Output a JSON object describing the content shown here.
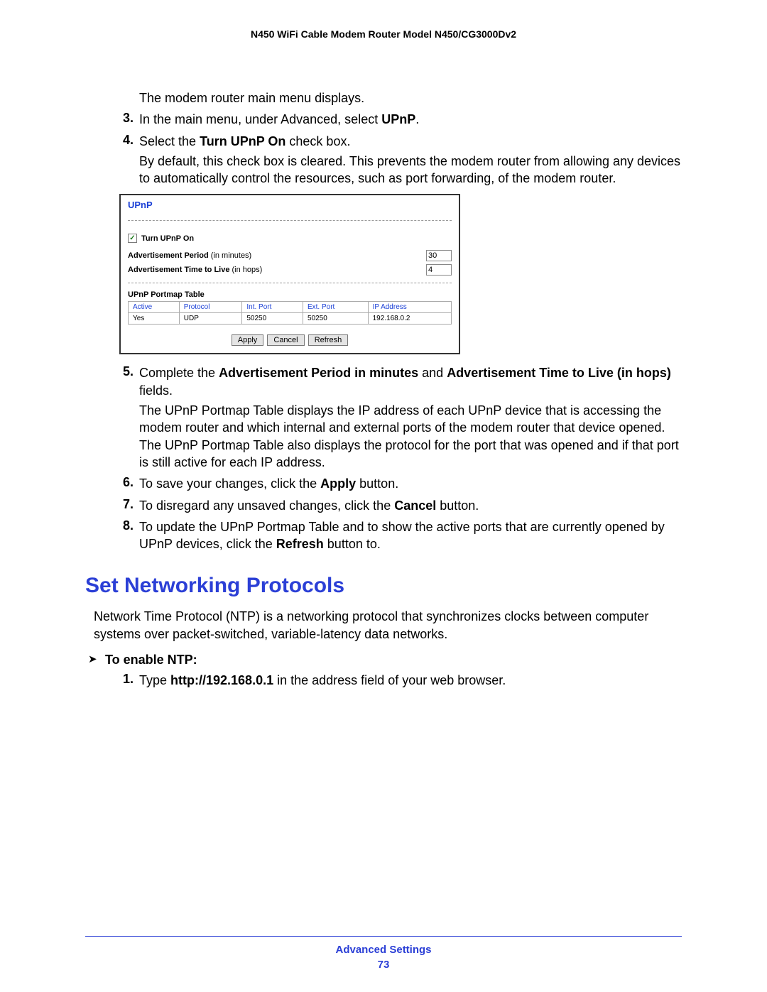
{
  "header": {
    "title": "N450 WiFi Cable Modem Router Model N450/CG3000Dv2"
  },
  "intro_continuation": "The modem router main menu displays.",
  "steps": [
    {
      "num": "3.",
      "parts": [
        "In the main menu, under Advanced, select ",
        "UPnP",
        "."
      ]
    },
    {
      "num": "4.",
      "parts": [
        "Select the ",
        "Turn UPnP On",
        " check box."
      ],
      "continuation": "By default, this check box is cleared. This prevents the modem router from allowing any devices to automatically control the resources, such as port forwarding, of the modem router."
    },
    {
      "num": "5.",
      "parts": [
        "Complete the ",
        "Advertisement Period in minutes",
        " and ",
        "Advertisement Time to Live (in hops)",
        " fields."
      ],
      "continuation": "The UPnP Portmap Table displays the IP address of each UPnP device that is accessing the modem router and which internal and external ports of the modem router that device opened. The UPnP Portmap Table also displays the protocol for the port that was opened and if that port is still active for each IP address."
    },
    {
      "num": "6.",
      "parts": [
        "To save your changes, click the ",
        "Apply",
        " button."
      ]
    },
    {
      "num": "7.",
      "parts": [
        "To disregard any unsaved changes, click the ",
        "Cancel",
        " button."
      ]
    },
    {
      "num": "8.",
      "parts": [
        "To update the UPnP Portmap Table and to show the active ports that are currently opened by UPnP devices, click the ",
        "Refresh",
        " button to."
      ]
    }
  ],
  "upnp_panel": {
    "title": "UPnP",
    "checkbox_label": "Turn UPnP On",
    "checkbox_checked": "✓",
    "field1_bold": "Advertisement Period",
    "field1_rest": " (in minutes)",
    "field1_value": "30",
    "field2_bold": "Advertisement Time to Live",
    "field2_rest": " (in hops)",
    "field2_value": "4",
    "table_title": "UPnP Portmap Table",
    "headers": [
      "Active",
      "Protocol",
      "Int. Port",
      "Ext. Port",
      "IP Address"
    ],
    "row": [
      "Yes",
      "UDP",
      "50250",
      "50250",
      "192.168.0.2"
    ],
    "buttons": [
      "Apply",
      "Cancel",
      "Refresh"
    ]
  },
  "section_heading": "Set Networking Protocols",
  "section_para": "Network Time Protocol (NTP) is a networking protocol that synchronizes clocks between computer systems over packet-switched, variable-latency data networks.",
  "arrow_task": "To enable NTP:",
  "ntp_steps": [
    {
      "num": "1.",
      "parts": [
        "Type ",
        "http://192.168.0.1",
        " in the address field of your web browser."
      ]
    }
  ],
  "footer": {
    "title": "Advanced Settings",
    "page": "73"
  }
}
